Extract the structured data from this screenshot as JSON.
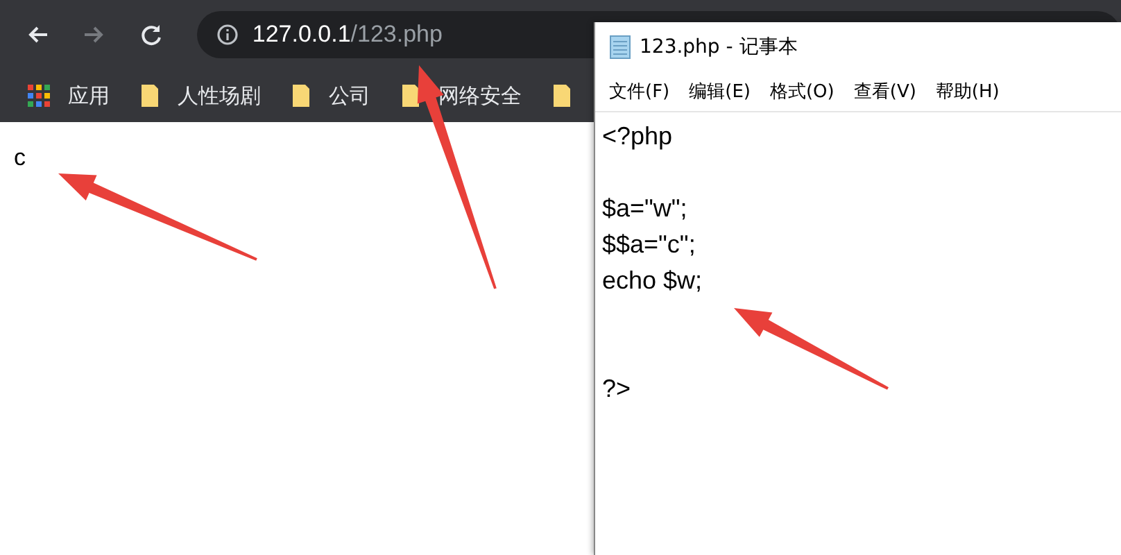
{
  "browser": {
    "nav_buttons": [
      {
        "kind": "back",
        "disabled": false
      },
      {
        "kind": "forward",
        "disabled": true
      },
      {
        "kind": "reload",
        "disabled": false
      }
    ],
    "address": {
      "host": "127.0.0.1",
      "path": "/123.php"
    },
    "bookmarks": [
      {
        "kind": "apps",
        "label": "应用"
      },
      {
        "kind": "folder",
        "label": "人性场剧"
      },
      {
        "kind": "folder",
        "label": "公司"
      },
      {
        "kind": "folder",
        "label": "网络安全"
      },
      {
        "kind": "folder"
      }
    ],
    "page_text": "c"
  },
  "notepad": {
    "title": "123.php - 记事本",
    "menu": [
      "文件(F)",
      "编辑(E)",
      "格式(O)",
      "查看(V)",
      "帮助(H)"
    ],
    "content": "<?php\n\n$a=\"w\";\n$$a=\"c\";\necho $w;\n\n\n?>"
  },
  "annotation_arrows": [
    {
      "kind": "arrow"
    },
    {
      "kind": "arrow"
    },
    {
      "kind": "arrow"
    }
  ]
}
